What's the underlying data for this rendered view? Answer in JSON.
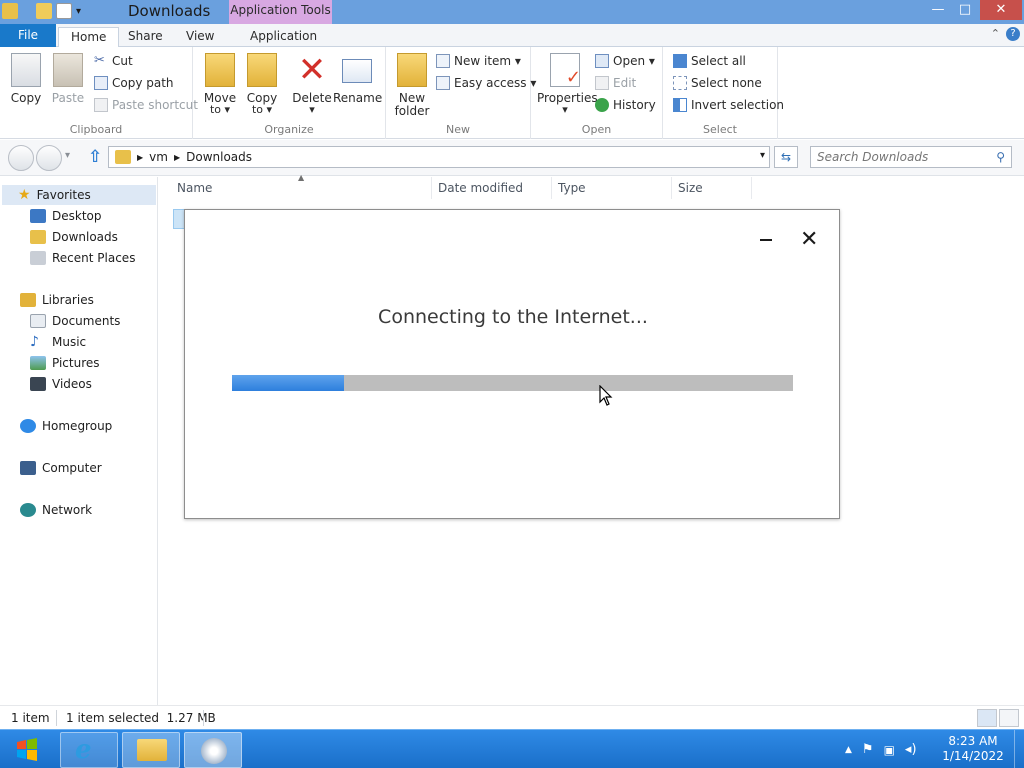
{
  "window": {
    "title": "Downloads",
    "context_tab_group": "Application Tools",
    "controls": {
      "minimize": "—",
      "maximize": "□",
      "close": "✕"
    }
  },
  "ribbon_tabs": [
    "File",
    "Home",
    "Share",
    "View",
    "Application"
  ],
  "ribbon": {
    "clipboard": {
      "label": "Clipboard",
      "copy": "Copy",
      "paste": "Paste",
      "cut": "Cut",
      "copy_path": "Copy path",
      "paste_shortcut": "Paste shortcut"
    },
    "organize": {
      "label": "Organize",
      "move_to_1": "Move",
      "move_to_2": "to ▾",
      "copy_to_1": "Copy",
      "copy_to_2": "to ▾",
      "delete_1": "Delete",
      "delete_2": "▾",
      "rename": "Rename"
    },
    "new": {
      "label": "New",
      "new_folder_1": "New",
      "new_folder_2": "folder",
      "new_item": "New item ▾",
      "easy_access": "Easy access ▾"
    },
    "open": {
      "label": "Open",
      "properties_1": "Properties",
      "properties_2": "▾",
      "open": "Open ▾",
      "edit": "Edit",
      "history": "History"
    },
    "select": {
      "label": "Select",
      "select_all": "Select all",
      "select_none": "Select none",
      "invert_selection": "Invert selection"
    }
  },
  "address": {
    "crumbs": [
      "vm",
      "Downloads"
    ],
    "search_placeholder": "Search Downloads"
  },
  "nav": {
    "favorites": "Favorites",
    "desktop": "Desktop",
    "downloads": "Downloads",
    "recent_places": "Recent Places",
    "libraries": "Libraries",
    "documents": "Documents",
    "music": "Music",
    "pictures": "Pictures",
    "videos": "Videos",
    "homegroup": "Homegroup",
    "computer": "Computer",
    "network": "Network"
  },
  "columns": [
    "Name",
    "Date modified",
    "Type",
    "Size"
  ],
  "dialog": {
    "message": "Connecting to the Internet...",
    "progress": 0.2
  },
  "status": {
    "items": "1 item",
    "selected": "1 item selected  1.27 MB"
  },
  "clock": {
    "time": "8:23 AM",
    "date": "1/14/2022"
  },
  "icons": {
    "file_menu_color": "#1979ca",
    "titlebar_color": "#6aa0de",
    "taskbar_color": "#1a6fc9"
  }
}
